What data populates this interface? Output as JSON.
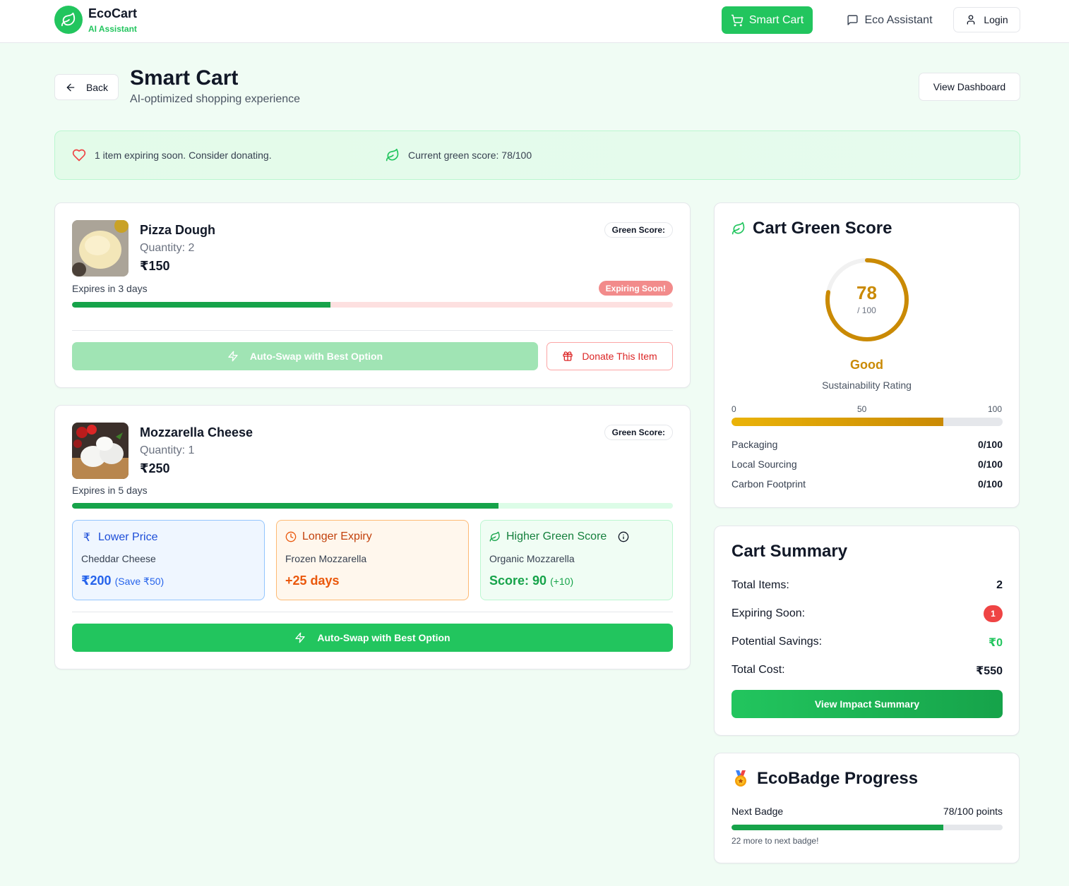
{
  "header": {
    "brand": "EcoCart",
    "brand_sub": "AI Assistant",
    "nav": {
      "smart_cart": "Smart Cart",
      "eco_assistant": "Eco Assistant",
      "login": "Login"
    }
  },
  "page": {
    "back": "Back",
    "title": "Smart Cart",
    "subtitle": "AI-optimized shopping experience",
    "dashboard_button": "View Dashboard"
  },
  "banner": {
    "expiring_text": "1 item expiring soon. Consider donating.",
    "green_text": "Current green score: 78/100"
  },
  "items": [
    {
      "name": "Pizza Dough",
      "quantity": "Quantity: 2",
      "price": "₹150",
      "green_score_label": "Green Score:",
      "expires": "Expires in 3 days",
      "expiring_badge": "Expiring Soon!",
      "shelf_life_fraction": 0.43,
      "swap_button": "Auto-Swap with Best Option",
      "donate_button": "Donate This Item"
    },
    {
      "name": "Mozzarella Cheese",
      "quantity": "Quantity: 1",
      "price": "₹250",
      "green_score_label": "Green Score:",
      "expires": "Expires in 5 days",
      "shelf_life_fraction": 0.71,
      "alternatives": {
        "price": {
          "title": "Lower Price",
          "item": "Cheddar Cheese",
          "value": "₹200",
          "note": "(Save ₹50)"
        },
        "expiry": {
          "title": "Longer Expiry",
          "item": "Frozen Mozzarella",
          "value": "+25 days"
        },
        "green": {
          "title": "Higher Green Score",
          "item": "Organic Mozzarella",
          "value": "Score: 90",
          "note": "(+10)"
        }
      },
      "swap_button": "Auto-Swap with Best Option"
    }
  ],
  "green_score_card": {
    "title": "Cart Green Score",
    "score": "78",
    "max": "/ 100",
    "score_fraction": 0.78,
    "rating": "Good",
    "rating_label": "Sustainability Rating",
    "scale": [
      "0",
      "50",
      "100"
    ],
    "breakdown": [
      {
        "label": "Packaging",
        "value": "0/100"
      },
      {
        "label": "Local Sourcing",
        "value": "0/100"
      },
      {
        "label": "Carbon Footprint",
        "value": "0/100"
      }
    ]
  },
  "summary": {
    "title": "Cart Summary",
    "total_items_label": "Total Items:",
    "total_items": "2",
    "expiring_label": "Expiring Soon:",
    "expiring": "1",
    "savings_label": "Potential Savings:",
    "savings": "₹0",
    "cost_label": "Total Cost:",
    "cost": "₹550",
    "impact_button": "View Impact Summary"
  },
  "badge": {
    "title": "EcoBadge Progress",
    "next_label": "Next Badge",
    "points": "78/100 points",
    "progress_fraction": 0.78,
    "remaining": "22 more to next badge!"
  },
  "colors": {
    "brand_green": "#22c55e",
    "dark_green": "#16a34a",
    "gold": "#ca8a04",
    "red": "#ef4444"
  }
}
